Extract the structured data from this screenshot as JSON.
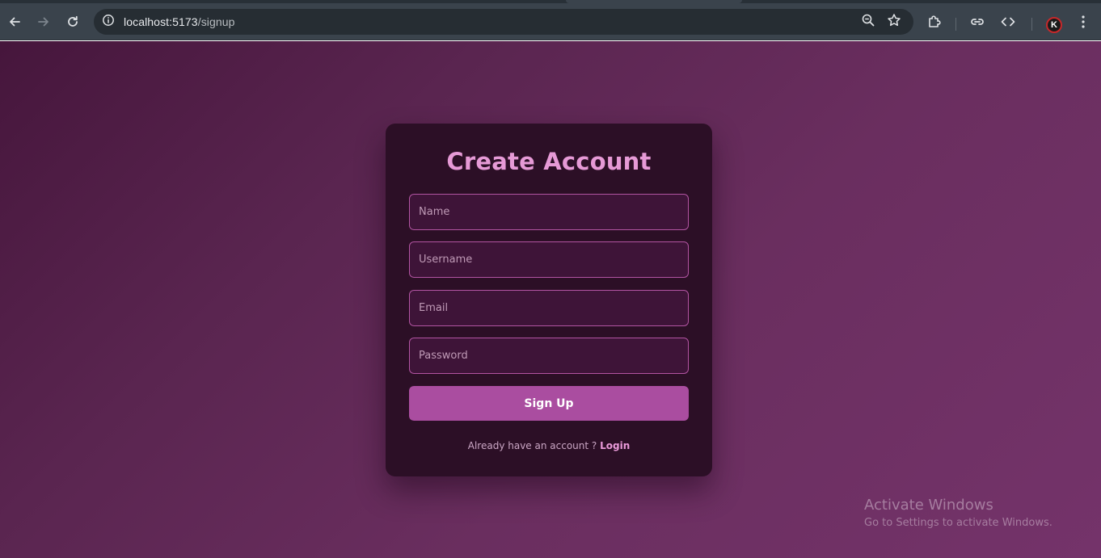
{
  "browser": {
    "url_host": "localhost:5173",
    "url_path": "/signup",
    "avatar_initial": "K",
    "icons": {
      "back": "arrow-left-icon",
      "forward": "arrow-right-icon",
      "reload": "reload-icon",
      "site_info": "info-icon",
      "zoom": "zoom-icon",
      "bookmark": "star-icon",
      "extensions": "puzzle-icon",
      "link": "link-icon",
      "devtools": "code-icon",
      "menu": "kebab-menu-icon"
    }
  },
  "signup": {
    "title": "Create Account",
    "fields": {
      "name_placeholder": "Name",
      "username_placeholder": "Username",
      "email_placeholder": "Email",
      "password_placeholder": "Password"
    },
    "submit_label": "Sign Up",
    "login_prompt": "Already have an account ?",
    "login_link": "Login"
  },
  "watermark": {
    "title": "Activate Windows",
    "subtitle": "Go to Settings to activate Windows."
  },
  "colors": {
    "card_background": "#2c0f26",
    "title_color": "#e69ad6",
    "button_color": "#aa4da0",
    "input_border": "#b254a2",
    "input_background": "#3e1438",
    "page_gradient_start": "#46163c",
    "page_gradient_end": "#74336a"
  }
}
